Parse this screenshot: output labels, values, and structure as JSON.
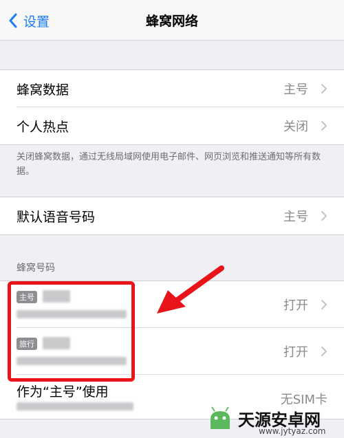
{
  "nav": {
    "back_label": "设置",
    "title": "蜂窝网络"
  },
  "group1": {
    "cellular_data": {
      "label": "蜂窝数据",
      "value": "主号"
    },
    "hotspot": {
      "label": "个人热点",
      "value": "关闭"
    }
  },
  "note": "关闭蜂窝数据，通过无线局域网使用电子邮件、网页浏览和推送通知等所有数据。",
  "group2": {
    "default_voice": {
      "label": "默认语音号码",
      "value": "主号"
    }
  },
  "section_header": "蜂窝号码",
  "lines": [
    {
      "tag": "主号",
      "value": "打开"
    },
    {
      "tag": "旅行",
      "value": "打开"
    }
  ],
  "primary_row": {
    "label": "作为“主号”使用",
    "value": "无SIM卡"
  },
  "watermark": {
    "text": "天源安卓网",
    "url": "www.jytyaz.com"
  },
  "colors": {
    "accent": "#1a7cf5",
    "highlight": "#e8141a",
    "arrow": "#e8141a"
  }
}
